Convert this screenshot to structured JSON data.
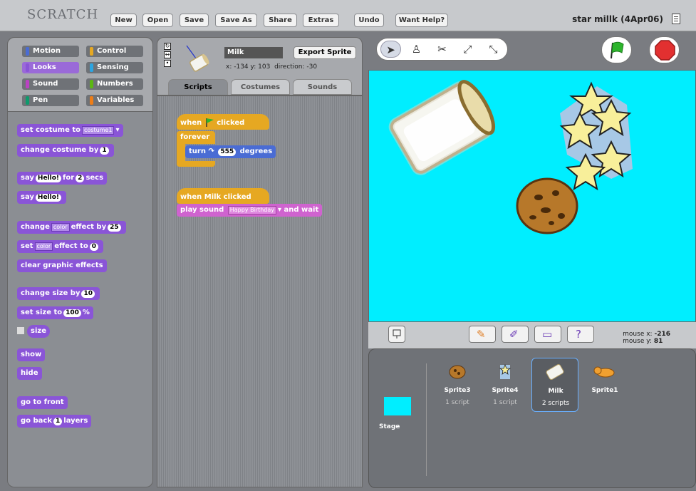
{
  "app": {
    "logo": "SCRATCH"
  },
  "toolbar": [
    {
      "label": "New"
    },
    {
      "label": "Open"
    },
    {
      "label": "Save"
    },
    {
      "label": "Save As"
    },
    {
      "label": "Share"
    },
    {
      "label": "Extras"
    },
    {
      "label": "Undo"
    },
    {
      "label": "Want Help?"
    }
  ],
  "project_title": "star millk (4Apr06)",
  "categories": [
    {
      "label": "Motion",
      "color": "#4a6cd4"
    },
    {
      "label": "Control",
      "color": "#e6a822"
    },
    {
      "label": "Looks",
      "color": "#8a55d7"
    },
    {
      "label": "Sensing",
      "color": "#2ca5e2"
    },
    {
      "label": "Sound",
      "color": "#bb42c3"
    },
    {
      "label": "Numbers",
      "color": "#5cb712"
    },
    {
      "label": "Pen",
      "color": "#0e9a6c"
    },
    {
      "label": "Variables",
      "color": "#ee7d16"
    }
  ],
  "selected_category": "Looks",
  "blocks": {
    "set_costume": {
      "text": "set costume to",
      "value": "costume1"
    },
    "change_costume": {
      "text": "change costume by",
      "value": "1"
    },
    "say_for": {
      "text": "say",
      "value": "Hello!",
      "mid": "for",
      "secs": "2",
      "end": "secs"
    },
    "say": {
      "text": "say",
      "value": "Hello!"
    },
    "change_effect": {
      "text": "change",
      "value": "color",
      "mid": "effect by",
      "num": "25"
    },
    "set_effect": {
      "text": "set",
      "value": "color",
      "mid": "effect to",
      "num": "0"
    },
    "clear_effects": {
      "text": "clear graphic effects"
    },
    "change_size": {
      "text": "change size by",
      "value": "10"
    },
    "set_size": {
      "text": "set size to",
      "value": "100",
      "unit": "%"
    },
    "size_reporter": {
      "text": "size"
    },
    "show": {
      "text": "show"
    },
    "hide": {
      "text": "hide"
    },
    "go_front": {
      "text": "go to front"
    },
    "go_back": {
      "text": "go back",
      "value": "1",
      "end": "layers"
    }
  },
  "sprite": {
    "name": "Milk",
    "export_label": "Export Sprite",
    "x_label": "x:",
    "x": "-134",
    "y_label": "y:",
    "y": "103",
    "dir_label": "direction:",
    "direction": "-30"
  },
  "tabs": [
    {
      "label": "Scripts"
    },
    {
      "label": "Costumes"
    },
    {
      "label": "Sounds"
    }
  ],
  "scripts": {
    "hat1": {
      "pre": "when",
      "post": "clicked"
    },
    "forever": "forever",
    "turn": {
      "pre": "turn",
      "value": "555",
      "post": "degrees"
    },
    "hat2": "when Milk clicked",
    "play": {
      "pre": "play sound",
      "value": "Happy Birthday",
      "post": "and wait"
    }
  },
  "mouse": {
    "x_label": "mouse x:",
    "x": "-216",
    "y_label": "mouse y:",
    "y": "81"
  },
  "stage_label": "Stage",
  "sprite_list": [
    {
      "name": "Sprite3",
      "scripts": "1 script"
    },
    {
      "name": "Sprite4",
      "scripts": "1 script"
    },
    {
      "name": "Milk",
      "scripts": "2 scripts"
    },
    {
      "name": "Sprite1",
      "scripts": ""
    }
  ]
}
